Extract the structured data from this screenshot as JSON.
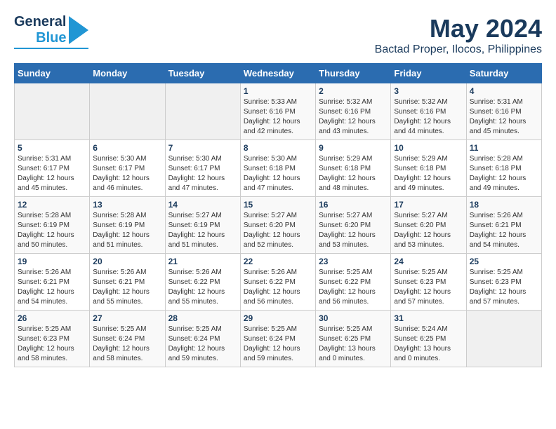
{
  "header": {
    "logo_line1": "General",
    "logo_line2": "Blue",
    "title": "May 2024",
    "subtitle": "Bactad Proper, Ilocos, Philippines"
  },
  "weekdays": [
    "Sunday",
    "Monday",
    "Tuesday",
    "Wednesday",
    "Thursday",
    "Friday",
    "Saturday"
  ],
  "weeks": [
    [
      {
        "day": "",
        "sunrise": "",
        "sunset": "",
        "daylight": ""
      },
      {
        "day": "",
        "sunrise": "",
        "sunset": "",
        "daylight": ""
      },
      {
        "day": "",
        "sunrise": "",
        "sunset": "",
        "daylight": ""
      },
      {
        "day": "1",
        "sunrise": "Sunrise: 5:33 AM",
        "sunset": "Sunset: 6:16 PM",
        "daylight": "Daylight: 12 hours and 42 minutes."
      },
      {
        "day": "2",
        "sunrise": "Sunrise: 5:32 AM",
        "sunset": "Sunset: 6:16 PM",
        "daylight": "Daylight: 12 hours and 43 minutes."
      },
      {
        "day": "3",
        "sunrise": "Sunrise: 5:32 AM",
        "sunset": "Sunset: 6:16 PM",
        "daylight": "Daylight: 12 hours and 44 minutes."
      },
      {
        "day": "4",
        "sunrise": "Sunrise: 5:31 AM",
        "sunset": "Sunset: 6:16 PM",
        "daylight": "Daylight: 12 hours and 45 minutes."
      }
    ],
    [
      {
        "day": "5",
        "sunrise": "Sunrise: 5:31 AM",
        "sunset": "Sunset: 6:17 PM",
        "daylight": "Daylight: 12 hours and 45 minutes."
      },
      {
        "day": "6",
        "sunrise": "Sunrise: 5:30 AM",
        "sunset": "Sunset: 6:17 PM",
        "daylight": "Daylight: 12 hours and 46 minutes."
      },
      {
        "day": "7",
        "sunrise": "Sunrise: 5:30 AM",
        "sunset": "Sunset: 6:17 PM",
        "daylight": "Daylight: 12 hours and 47 minutes."
      },
      {
        "day": "8",
        "sunrise": "Sunrise: 5:30 AM",
        "sunset": "Sunset: 6:18 PM",
        "daylight": "Daylight: 12 hours and 47 minutes."
      },
      {
        "day": "9",
        "sunrise": "Sunrise: 5:29 AM",
        "sunset": "Sunset: 6:18 PM",
        "daylight": "Daylight: 12 hours and 48 minutes."
      },
      {
        "day": "10",
        "sunrise": "Sunrise: 5:29 AM",
        "sunset": "Sunset: 6:18 PM",
        "daylight": "Daylight: 12 hours and 49 minutes."
      },
      {
        "day": "11",
        "sunrise": "Sunrise: 5:28 AM",
        "sunset": "Sunset: 6:18 PM",
        "daylight": "Daylight: 12 hours and 49 minutes."
      }
    ],
    [
      {
        "day": "12",
        "sunrise": "Sunrise: 5:28 AM",
        "sunset": "Sunset: 6:19 PM",
        "daylight": "Daylight: 12 hours and 50 minutes."
      },
      {
        "day": "13",
        "sunrise": "Sunrise: 5:28 AM",
        "sunset": "Sunset: 6:19 PM",
        "daylight": "Daylight: 12 hours and 51 minutes."
      },
      {
        "day": "14",
        "sunrise": "Sunrise: 5:27 AM",
        "sunset": "Sunset: 6:19 PM",
        "daylight": "Daylight: 12 hours and 51 minutes."
      },
      {
        "day": "15",
        "sunrise": "Sunrise: 5:27 AM",
        "sunset": "Sunset: 6:20 PM",
        "daylight": "Daylight: 12 hours and 52 minutes."
      },
      {
        "day": "16",
        "sunrise": "Sunrise: 5:27 AM",
        "sunset": "Sunset: 6:20 PM",
        "daylight": "Daylight: 12 hours and 53 minutes."
      },
      {
        "day": "17",
        "sunrise": "Sunrise: 5:27 AM",
        "sunset": "Sunset: 6:20 PM",
        "daylight": "Daylight: 12 hours and 53 minutes."
      },
      {
        "day": "18",
        "sunrise": "Sunrise: 5:26 AM",
        "sunset": "Sunset: 6:21 PM",
        "daylight": "Daylight: 12 hours and 54 minutes."
      }
    ],
    [
      {
        "day": "19",
        "sunrise": "Sunrise: 5:26 AM",
        "sunset": "Sunset: 6:21 PM",
        "daylight": "Daylight: 12 hours and 54 minutes."
      },
      {
        "day": "20",
        "sunrise": "Sunrise: 5:26 AM",
        "sunset": "Sunset: 6:21 PM",
        "daylight": "Daylight: 12 hours and 55 minutes."
      },
      {
        "day": "21",
        "sunrise": "Sunrise: 5:26 AM",
        "sunset": "Sunset: 6:22 PM",
        "daylight": "Daylight: 12 hours and 55 minutes."
      },
      {
        "day": "22",
        "sunrise": "Sunrise: 5:26 AM",
        "sunset": "Sunset: 6:22 PM",
        "daylight": "Daylight: 12 hours and 56 minutes."
      },
      {
        "day": "23",
        "sunrise": "Sunrise: 5:25 AM",
        "sunset": "Sunset: 6:22 PM",
        "daylight": "Daylight: 12 hours and 56 minutes."
      },
      {
        "day": "24",
        "sunrise": "Sunrise: 5:25 AM",
        "sunset": "Sunset: 6:23 PM",
        "daylight": "Daylight: 12 hours and 57 minutes."
      },
      {
        "day": "25",
        "sunrise": "Sunrise: 5:25 AM",
        "sunset": "Sunset: 6:23 PM",
        "daylight": "Daylight: 12 hours and 57 minutes."
      }
    ],
    [
      {
        "day": "26",
        "sunrise": "Sunrise: 5:25 AM",
        "sunset": "Sunset: 6:23 PM",
        "daylight": "Daylight: 12 hours and 58 minutes."
      },
      {
        "day": "27",
        "sunrise": "Sunrise: 5:25 AM",
        "sunset": "Sunset: 6:24 PM",
        "daylight": "Daylight: 12 hours and 58 minutes."
      },
      {
        "day": "28",
        "sunrise": "Sunrise: 5:25 AM",
        "sunset": "Sunset: 6:24 PM",
        "daylight": "Daylight: 12 hours and 59 minutes."
      },
      {
        "day": "29",
        "sunrise": "Sunrise: 5:25 AM",
        "sunset": "Sunset: 6:24 PM",
        "daylight": "Daylight: 12 hours and 59 minutes."
      },
      {
        "day": "30",
        "sunrise": "Sunrise: 5:25 AM",
        "sunset": "Sunset: 6:25 PM",
        "daylight": "Daylight: 13 hours and 0 minutes."
      },
      {
        "day": "31",
        "sunrise": "Sunrise: 5:24 AM",
        "sunset": "Sunset: 6:25 PM",
        "daylight": "Daylight: 13 hours and 0 minutes."
      },
      {
        "day": "",
        "sunrise": "",
        "sunset": "",
        "daylight": ""
      }
    ]
  ]
}
